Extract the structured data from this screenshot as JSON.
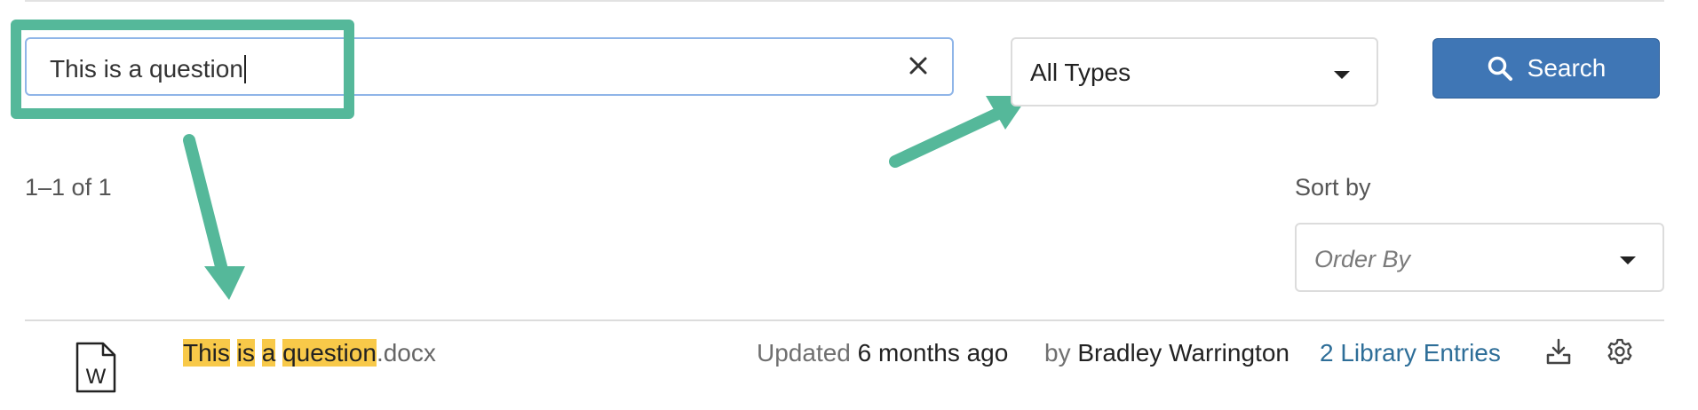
{
  "search": {
    "value": "This is a question",
    "clear_label": "×"
  },
  "type_filter": {
    "selected": "All Types"
  },
  "search_button": {
    "label": "Search"
  },
  "results": {
    "count_text": "1–1 of 1"
  },
  "sort": {
    "label": "Sort by",
    "placeholder": "Order By"
  },
  "file": {
    "name_parts": [
      "This",
      "is",
      "a",
      "question"
    ],
    "extension": ".docx",
    "updated_label": "Updated",
    "updated_value": "6 months ago",
    "by_label": "by",
    "author": "Bradley Warrington",
    "library_entries": "2 Library Entries",
    "icon_letter": "W"
  },
  "colors": {
    "accent_annotation": "#55b89a",
    "search_button": "#3f76b5",
    "highlight": "#f8c949",
    "link": "#2e6e98"
  }
}
